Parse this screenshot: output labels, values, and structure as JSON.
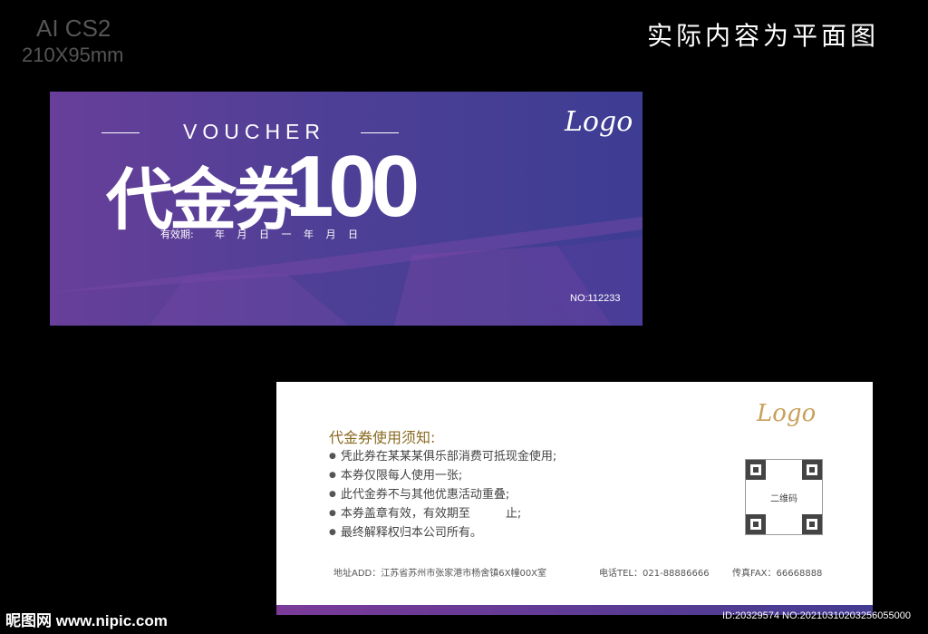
{
  "spec": {
    "software": "AI CS2",
    "size": "210X95mm"
  },
  "note": "实际内容为平面图",
  "front": {
    "heading": "VOUCHER",
    "title": "代金券",
    "currency": "¥",
    "amount": "100",
    "validity_label": "有效期:",
    "validity_dates": "年 月 日 一 年 月 日",
    "logo": "Logo",
    "serial": "NO:112233",
    "colors": {
      "start": "#683f9a",
      "end": "#3d3d93"
    }
  },
  "back": {
    "logo": "Logo",
    "rules_title": "代金券使用须知:",
    "rules": [
      "凭此券在某某某俱乐部消费可抵现金使用;",
      "本券仅限每人使用一张;",
      "此代金券不与其他优惠活动重叠;",
      "本券盖章有效，有效期至　　　止;",
      "最终解释权归本公司所有。"
    ],
    "qr_label": "二维码",
    "address": "地址ADD：江苏省苏州市张家港市杨舍镇6X幢00X室",
    "tel": "电话TEL：021-88886666",
    "fax": "传真FAX：66668888"
  },
  "watermark": {
    "site": "昵图网 www.nipic.com",
    "id": "ID:20329574 NO:20210310203256055000"
  }
}
